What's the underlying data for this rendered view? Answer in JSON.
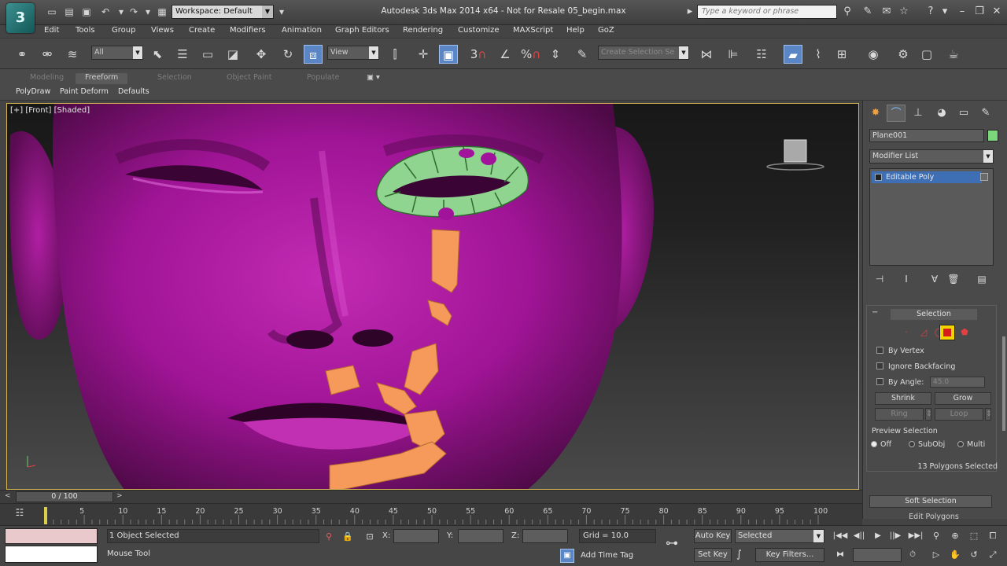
{
  "app": {
    "logo_letter": "3",
    "title": "Autodesk 3ds Max  2014 x64   - Not for Resale   05_begin.max",
    "workspace": "Workspace: Default",
    "search_placeholder": "Type a keyword or phrase"
  },
  "menu": [
    "Edit",
    "Tools",
    "Group",
    "Views",
    "Create",
    "Modifiers",
    "Animation",
    "Graph Editors",
    "Rendering",
    "Customize",
    "MAXScript",
    "Help",
    "GoZ"
  ],
  "toolbar": {
    "filter_value": "All",
    "refcoord_value": "View",
    "named_selection_placeholder": "Create Selection Se",
    "snap_label": "3",
    "angle_snap_label": "%"
  },
  "ribbon": {
    "tabs": [
      "Modeling",
      "Freeform",
      "Selection",
      "Object Paint",
      "Populate"
    ],
    "active_tab": "Freeform",
    "subtabs": [
      "PolyDraw",
      "Paint Deform",
      "Defaults"
    ]
  },
  "viewport": {
    "label": "[+] [Front] [Shaded]"
  },
  "command_panel": {
    "object_name": "Plane001",
    "object_color": "#7cd67c",
    "modifier_list": "Modifier List",
    "stack_item": "Editable Poly",
    "selection_title": "Selection",
    "by_vertex": "By Vertex",
    "ignore_backfacing": "Ignore Backfacing",
    "by_angle": "By Angle:",
    "by_angle_value": "45.0",
    "shrink": "Shrink",
    "grow": "Grow",
    "ring": "Ring",
    "loop": "Loop",
    "preview_selection": "Preview Selection",
    "preview_off": "Off",
    "preview_subobj": "SubObj",
    "preview_multi": "Multi",
    "selection_status": "13 Polygons Selected",
    "soft_selection": "Soft Selection",
    "edit_polygons": "Edit Polygons"
  },
  "timeline": {
    "frame_display": "0 / 100",
    "ticks": [
      "0",
      "5",
      "10",
      "15",
      "20",
      "25",
      "30",
      "35",
      "40",
      "45",
      "50",
      "55",
      "60",
      "65",
      "70",
      "75",
      "80",
      "85",
      "90",
      "95",
      "100"
    ]
  },
  "status": {
    "objects_selected": "1 Object Selected",
    "prompt": "Mouse Tool",
    "x_label": "X:",
    "y_label": "Y:",
    "z_label": "Z:",
    "grid": "Grid = 10.0",
    "add_time_tag": "Add Time Tag",
    "auto_key": "Auto Key",
    "set_key": "Set Key",
    "selected_dropdown": "Selected",
    "key_filters": "Key Filters..."
  },
  "colors": {
    "skin": "#b41ca6",
    "selection_green": "#8fd48f",
    "uv_orange": "#f59a5a",
    "viewport_border": "#d6b552",
    "active_blue": "#5a86c5",
    "subobj_active": "#f2d500"
  }
}
